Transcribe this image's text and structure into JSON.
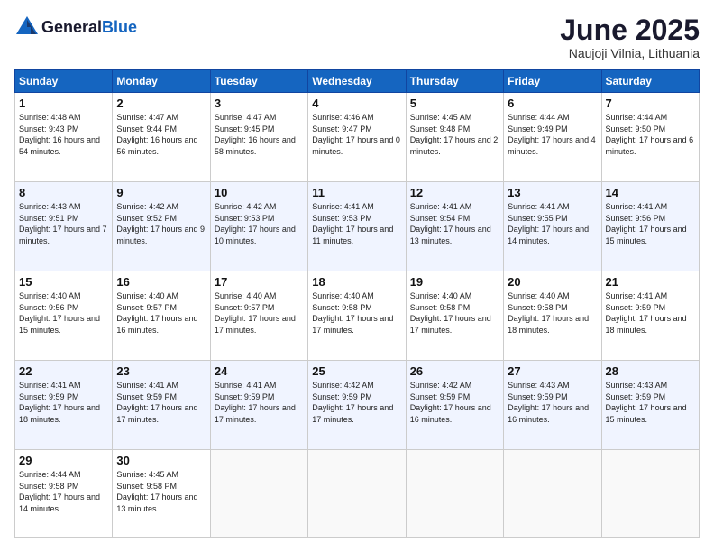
{
  "header": {
    "logo_general": "General",
    "logo_blue": "Blue",
    "month_title": "June 2025",
    "subtitle": "Naujoji Vilnia, Lithuania"
  },
  "days_of_week": [
    "Sunday",
    "Monday",
    "Tuesday",
    "Wednesday",
    "Thursday",
    "Friday",
    "Saturday"
  ],
  "weeks": [
    [
      {
        "day": "1",
        "sunrise": "Sunrise: 4:48 AM",
        "sunset": "Sunset: 9:43 PM",
        "daylight": "Daylight: 16 hours and 54 minutes."
      },
      {
        "day": "2",
        "sunrise": "Sunrise: 4:47 AM",
        "sunset": "Sunset: 9:44 PM",
        "daylight": "Daylight: 16 hours and 56 minutes."
      },
      {
        "day": "3",
        "sunrise": "Sunrise: 4:47 AM",
        "sunset": "Sunset: 9:45 PM",
        "daylight": "Daylight: 16 hours and 58 minutes."
      },
      {
        "day": "4",
        "sunrise": "Sunrise: 4:46 AM",
        "sunset": "Sunset: 9:47 PM",
        "daylight": "Daylight: 17 hours and 0 minutes."
      },
      {
        "day": "5",
        "sunrise": "Sunrise: 4:45 AM",
        "sunset": "Sunset: 9:48 PM",
        "daylight": "Daylight: 17 hours and 2 minutes."
      },
      {
        "day": "6",
        "sunrise": "Sunrise: 4:44 AM",
        "sunset": "Sunset: 9:49 PM",
        "daylight": "Daylight: 17 hours and 4 minutes."
      },
      {
        "day": "7",
        "sunrise": "Sunrise: 4:44 AM",
        "sunset": "Sunset: 9:50 PM",
        "daylight": "Daylight: 17 hours and 6 minutes."
      }
    ],
    [
      {
        "day": "8",
        "sunrise": "Sunrise: 4:43 AM",
        "sunset": "Sunset: 9:51 PM",
        "daylight": "Daylight: 17 hours and 7 minutes."
      },
      {
        "day": "9",
        "sunrise": "Sunrise: 4:42 AM",
        "sunset": "Sunset: 9:52 PM",
        "daylight": "Daylight: 17 hours and 9 minutes."
      },
      {
        "day": "10",
        "sunrise": "Sunrise: 4:42 AM",
        "sunset": "Sunset: 9:53 PM",
        "daylight": "Daylight: 17 hours and 10 minutes."
      },
      {
        "day": "11",
        "sunrise": "Sunrise: 4:41 AM",
        "sunset": "Sunset: 9:53 PM",
        "daylight": "Daylight: 17 hours and 11 minutes."
      },
      {
        "day": "12",
        "sunrise": "Sunrise: 4:41 AM",
        "sunset": "Sunset: 9:54 PM",
        "daylight": "Daylight: 17 hours and 13 minutes."
      },
      {
        "day": "13",
        "sunrise": "Sunrise: 4:41 AM",
        "sunset": "Sunset: 9:55 PM",
        "daylight": "Daylight: 17 hours and 14 minutes."
      },
      {
        "day": "14",
        "sunrise": "Sunrise: 4:41 AM",
        "sunset": "Sunset: 9:56 PM",
        "daylight": "Daylight: 17 hours and 15 minutes."
      }
    ],
    [
      {
        "day": "15",
        "sunrise": "Sunrise: 4:40 AM",
        "sunset": "Sunset: 9:56 PM",
        "daylight": "Daylight: 17 hours and 15 minutes."
      },
      {
        "day": "16",
        "sunrise": "Sunrise: 4:40 AM",
        "sunset": "Sunset: 9:57 PM",
        "daylight": "Daylight: 17 hours and 16 minutes."
      },
      {
        "day": "17",
        "sunrise": "Sunrise: 4:40 AM",
        "sunset": "Sunset: 9:57 PM",
        "daylight": "Daylight: 17 hours and 17 minutes."
      },
      {
        "day": "18",
        "sunrise": "Sunrise: 4:40 AM",
        "sunset": "Sunset: 9:58 PM",
        "daylight": "Daylight: 17 hours and 17 minutes."
      },
      {
        "day": "19",
        "sunrise": "Sunrise: 4:40 AM",
        "sunset": "Sunset: 9:58 PM",
        "daylight": "Daylight: 17 hours and 17 minutes."
      },
      {
        "day": "20",
        "sunrise": "Sunrise: 4:40 AM",
        "sunset": "Sunset: 9:58 PM",
        "daylight": "Daylight: 17 hours and 18 minutes."
      },
      {
        "day": "21",
        "sunrise": "Sunrise: 4:41 AM",
        "sunset": "Sunset: 9:59 PM",
        "daylight": "Daylight: 17 hours and 18 minutes."
      }
    ],
    [
      {
        "day": "22",
        "sunrise": "Sunrise: 4:41 AM",
        "sunset": "Sunset: 9:59 PM",
        "daylight": "Daylight: 17 hours and 18 minutes."
      },
      {
        "day": "23",
        "sunrise": "Sunrise: 4:41 AM",
        "sunset": "Sunset: 9:59 PM",
        "daylight": "Daylight: 17 hours and 17 minutes."
      },
      {
        "day": "24",
        "sunrise": "Sunrise: 4:41 AM",
        "sunset": "Sunset: 9:59 PM",
        "daylight": "Daylight: 17 hours and 17 minutes."
      },
      {
        "day": "25",
        "sunrise": "Sunrise: 4:42 AM",
        "sunset": "Sunset: 9:59 PM",
        "daylight": "Daylight: 17 hours and 17 minutes."
      },
      {
        "day": "26",
        "sunrise": "Sunrise: 4:42 AM",
        "sunset": "Sunset: 9:59 PM",
        "daylight": "Daylight: 17 hours and 16 minutes."
      },
      {
        "day": "27",
        "sunrise": "Sunrise: 4:43 AM",
        "sunset": "Sunset: 9:59 PM",
        "daylight": "Daylight: 17 hours and 16 minutes."
      },
      {
        "day": "28",
        "sunrise": "Sunrise: 4:43 AM",
        "sunset": "Sunset: 9:59 PM",
        "daylight": "Daylight: 17 hours and 15 minutes."
      }
    ],
    [
      {
        "day": "29",
        "sunrise": "Sunrise: 4:44 AM",
        "sunset": "Sunset: 9:58 PM",
        "daylight": "Daylight: 17 hours and 14 minutes."
      },
      {
        "day": "30",
        "sunrise": "Sunrise: 4:45 AM",
        "sunset": "Sunset: 9:58 PM",
        "daylight": "Daylight: 17 hours and 13 minutes."
      },
      null,
      null,
      null,
      null,
      null
    ]
  ]
}
